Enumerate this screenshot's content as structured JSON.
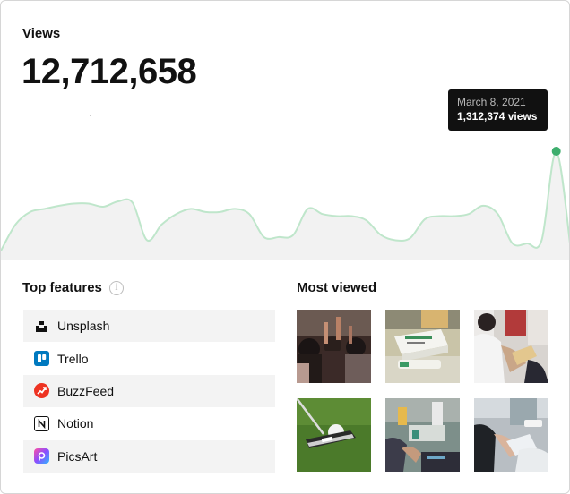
{
  "stats": {
    "label": "Views",
    "total": "12,712,658"
  },
  "tooltip": {
    "date": "March 8, 2021",
    "value": "1,312,374 views"
  },
  "chart_data": {
    "type": "area",
    "series": [
      {
        "values": [
          0.05,
          0.3,
          0.42,
          0.45,
          0.48,
          0.5,
          0.5,
          0.47,
          0.52,
          0.51,
          0.15,
          0.3,
          0.4,
          0.45,
          0.42,
          0.42,
          0.45,
          0.4,
          0.18,
          0.18,
          0.2,
          0.45,
          0.4,
          0.38,
          0.38,
          0.34,
          0.2,
          0.15,
          0.17,
          0.35,
          0.38,
          0.38,
          0.4,
          0.48,
          0.4,
          0.12,
          0.12,
          0.15,
          1.0,
          0.05
        ]
      }
    ],
    "highlight_index": 38,
    "line_color": "#bfe6cb",
    "dot_color": "#3dae6d",
    "grid": false
  },
  "top_features": {
    "title": "Top features",
    "items": [
      {
        "label": "Unsplash",
        "icon": "unsplash-icon",
        "color": "#111111"
      },
      {
        "label": "Trello",
        "icon": "trello-icon",
        "color": "#0079bf"
      },
      {
        "label": "BuzzFeed",
        "icon": "buzzfeed-icon",
        "color": "#ee3322"
      },
      {
        "label": "Notion",
        "icon": "notion-icon",
        "color": "#111111"
      },
      {
        "label": "PicsArt",
        "icon": "picsart-icon",
        "color": "#c549d8"
      }
    ]
  },
  "most_viewed": {
    "title": "Most viewed",
    "thumbnails": [
      {
        "subject": "crowd-photo"
      },
      {
        "subject": "vaccine-box-photo"
      },
      {
        "subject": "vaccination-photo"
      },
      {
        "subject": "golf-ball-photo"
      },
      {
        "subject": "lab-photo"
      },
      {
        "subject": "injection-photo"
      }
    ]
  }
}
